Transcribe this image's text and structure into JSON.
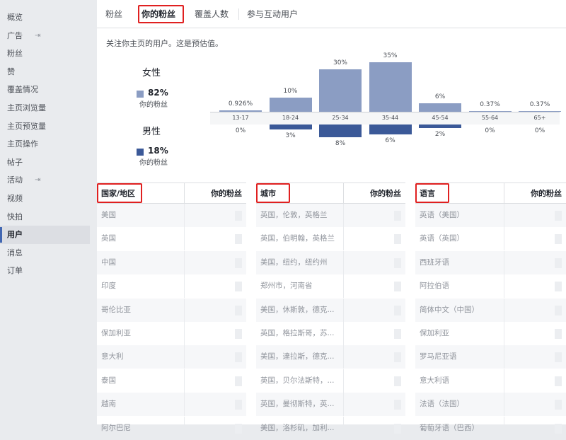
{
  "sidebar": {
    "items": [
      {
        "label": "概览"
      },
      {
        "label": "广告",
        "ext": "⇥"
      },
      {
        "label": "粉丝"
      },
      {
        "label": "赞"
      },
      {
        "label": "覆盖情况"
      },
      {
        "label": "主页浏览量"
      },
      {
        "label": "主页预览量"
      },
      {
        "label": "主页操作"
      },
      {
        "label": "帖子"
      },
      {
        "label": "活动",
        "ext": "⇥"
      },
      {
        "label": "视频"
      },
      {
        "label": "快拍"
      },
      {
        "label": "用户",
        "active": true
      },
      {
        "label": "消息"
      },
      {
        "label": "订单"
      }
    ]
  },
  "tabs": [
    {
      "label": "粉丝"
    },
    {
      "label": "你的粉丝",
      "active": true
    },
    {
      "label": "覆盖人数"
    },
    {
      "label": "参与互动用户"
    }
  ],
  "subtitle": "关注你主页的用户。这是预估值。",
  "gender": {
    "female": {
      "label": "女性",
      "percent": "82%",
      "sub": "你的粉丝",
      "color": "#8b9dc3"
    },
    "male": {
      "label": "男性",
      "percent": "18%",
      "sub": "你的粉丝",
      "color": "#3b5998"
    }
  },
  "chart_data": {
    "type": "bar",
    "categories": [
      "13-17",
      "18-24",
      "25-34",
      "35-44",
      "45-54",
      "55-64",
      "65+"
    ],
    "series": [
      {
        "name": "女性",
        "values": [
          0.926,
          10,
          30,
          35,
          6,
          0.37,
          0.37
        ],
        "labels": [
          "0.926%",
          "10%",
          "30%",
          "35%",
          "6%",
          "0.37%",
          "0.37%"
        ],
        "color": "#8b9dc3"
      },
      {
        "name": "男性",
        "values": [
          0,
          3,
          8,
          6,
          2,
          0,
          0
        ],
        "labels": [
          "0%",
          "3%",
          "8%",
          "6%",
          "2%",
          "0%",
          "0%"
        ],
        "color": "#3b5998"
      }
    ]
  },
  "tables": {
    "country": {
      "header": "国家/地区",
      "value_header": "你的粉丝",
      "rows": [
        "美国",
        "英国",
        "中国",
        "印度",
        "哥伦比亚",
        "保加利亚",
        "意大利",
        "泰国",
        "越南",
        "阿尔巴尼"
      ]
    },
    "city": {
      "header": "城市",
      "value_header": "你的粉丝",
      "rows": [
        "英国，伦敦，英格兰",
        "英国，伯明翰，英格兰",
        "美国，纽约，纽约州",
        "郑州市，河南省",
        "美国，休斯敦，德克...",
        "英国，格拉斯哥，苏...",
        "美国，達拉斯，德克...",
        "英国，贝尔法斯特，...",
        "英国，曼彻斯特，英...",
        "美国，洛杉矶，加利..."
      ]
    },
    "language": {
      "header": "语言",
      "value_header": "你的粉丝",
      "rows": [
        "英语（美国）",
        "英语（英国）",
        "西班牙语",
        "阿拉伯语",
        "简体中文（中国）",
        "保加利亚",
        "罗马尼亚语",
        "意大利语",
        "法语（法国）",
        "葡萄牙语（巴西）"
      ]
    }
  },
  "colors": {
    "highlight": "#e02020",
    "accent": "#4267b2"
  }
}
